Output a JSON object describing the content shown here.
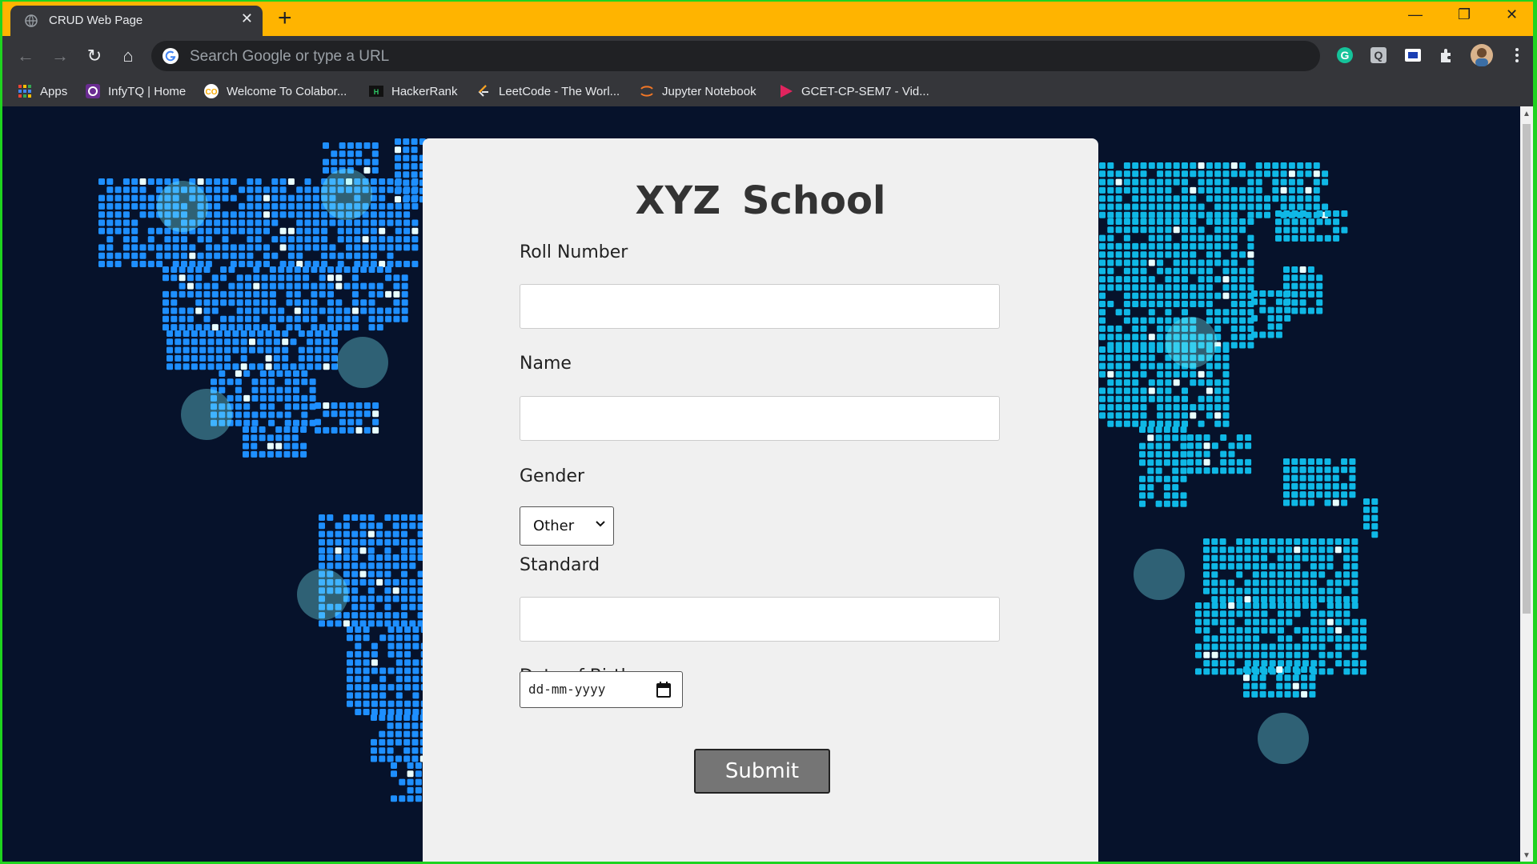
{
  "browser": {
    "tab_title": "CRUD Web Page",
    "tab_close": "✕",
    "new_tab": "+",
    "window_controls": {
      "minimize": "—",
      "restore": "❐",
      "close": "✕"
    },
    "nav": {
      "back": "←",
      "forward": "→",
      "reload": "↻",
      "home": "⌂"
    },
    "omnibox_placeholder": "Search Google or type a URL",
    "bookmarks": [
      {
        "label": "Apps",
        "icon": "apps-grid-icon"
      },
      {
        "label": "InfyTQ | Home",
        "icon": "infytq-icon"
      },
      {
        "label": "Welcome To Colabor...",
        "icon": "colab-icon"
      },
      {
        "label": "HackerRank",
        "icon": "hackerrank-icon"
      },
      {
        "label": "LeetCode - The Worl...",
        "icon": "leetcode-icon"
      },
      {
        "label": "Jupyter Notebook",
        "icon": "jupyter-icon"
      },
      {
        "label": "GCET-CP-SEM7 - Vid...",
        "icon": "video-icon"
      }
    ],
    "extensions": [
      "grammarly-icon",
      "q-extension-icon",
      "screen-capture-icon",
      "extensions-puzzle-icon",
      "profile-avatar",
      "more-menu-icon"
    ],
    "colors": {
      "tab_strip": "#ffb400",
      "toolbar": "#35363a",
      "window_border": "#1fd31f"
    }
  },
  "form": {
    "title": "XYZ School",
    "roll_label": "Roll Number",
    "roll_value": "",
    "name_label": "Name",
    "name_value": "",
    "gender_label": "Gender",
    "gender_selected": "Other",
    "standard_label": "Standard",
    "standard_value": "",
    "dob_label": "Date of Birth",
    "dob_placeholder": "dd-mm-yyyy",
    "submit_label": "Submit"
  },
  "background": {
    "description_icon": "world-map-dots",
    "colors": {
      "page": "#06122b",
      "dots_americas": "#1e8fff",
      "dots_asia": "#0fb8e6",
      "glow": "#7ff5ff"
    }
  }
}
